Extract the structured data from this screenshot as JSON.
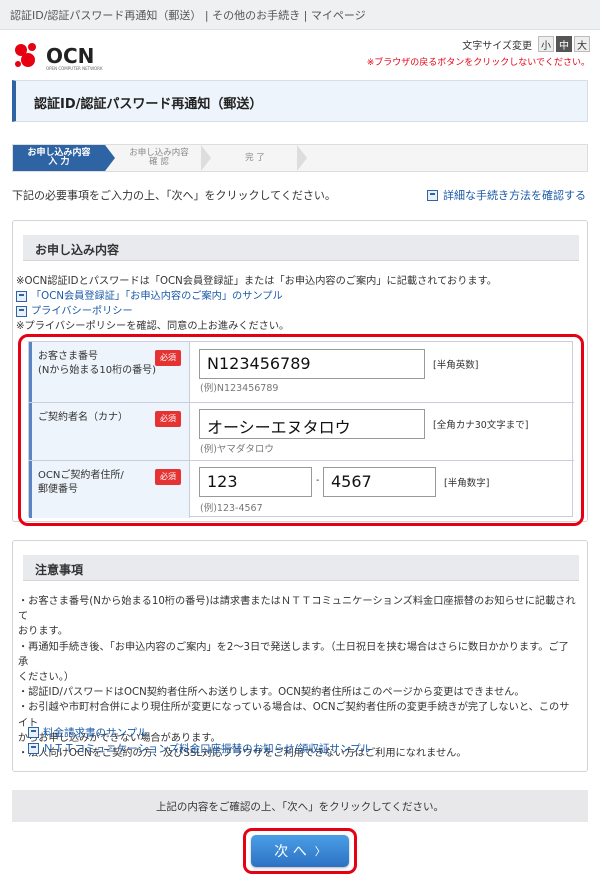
{
  "breadcrumb": "認証ID/認証パスワード再通知（郵送） | その他のお手続き | マイページ",
  "logo": {
    "text": "OCN",
    "sub": "OPEN COMPUTER NETWORK"
  },
  "font_size": {
    "label": "文字サイズ変更",
    "small": "小",
    "medium": "中",
    "large": "大"
  },
  "browser_warning": "※ブラウザの戻るボタンをクリックしないでください。",
  "page_title": "認証ID/認証パスワード再通知（郵送）",
  "steps": [
    {
      "line1": "お申し込み内容",
      "line2": "入 力"
    },
    {
      "line1": "お申し込み内容",
      "line2": "確 認"
    },
    {
      "line1": "完 了",
      "line2": ""
    }
  ],
  "instruction": "下記の必要事項をご入力の上、「次へ」をクリックしてください。",
  "detail_link": "詳細な手続き方法を確認する",
  "section1": {
    "title": "お申し込み内容",
    "note1": "※OCN認証IDとパスワードは「OCN会員登録証」または「お申込内容のご案内」に記載されております。",
    "link1": "「OCN会員登録証」「お申込内容のご案内」のサンプル",
    "link2": "プライバシーポリシー",
    "note2": "※プライバシーポリシーを確認、同意の上お進みください。"
  },
  "required_label": "必須",
  "form": {
    "customer": {
      "label1": "お客さま番号",
      "label2": "(Nから始まる10桁の番号)",
      "value": "N123456789",
      "hint": "[半角英数]",
      "example": "(例)N123456789"
    },
    "name": {
      "label1": "ご契約者名（カナ）",
      "value": "オーシーエヌタロウ",
      "hint": "[全角カナ30文字まで]",
      "example": "(例)ヤマダタロウ"
    },
    "zip": {
      "label1": "OCNご契約者住所/",
      "label2": "郵便番号",
      "value1": "123",
      "sep": "-",
      "value2": "4567",
      "hint": "[半角数字]",
      "example": "(例)123-4567"
    }
  },
  "section2": {
    "title": "注意事項",
    "lines": [
      "・お客さま番号(Nから始まる10桁の番号)は請求書またはＮＴＴコミュニケーションズ料金口座振替のお知らせに記載されて",
      "おります。",
      "・再通知手続き後、「お申込内容のご案内」を2～3日で発送します。（土日祝日を挟む場合はさらに数日かかります。ご了承",
      "ください。）",
      "・認証ID/パスワードはOCN契約者住所へお送りします。OCN契約者住所はこのページから変更はできません。",
      "・お引越や市町村合併により現住所が変更になっている場合は、OCNご契約者住所の変更手続きが完了しないと、このサイト",
      "からお申し込みができない場合があります。",
      "・法人向けOCNをご契約の方、及びSSL対応ブラウザをご利用できない方はご利用になれません。"
    ],
    "link1": "料金請求書のサンプル",
    "link2": "ＮＴＴコミュニケーションズ料金口座振替のお知らせ/領収証サンプル"
  },
  "bottom_instruction": "上記の内容をご確認の上、「次へ」をクリックしてください。",
  "next_button": "次 へ",
  "next_arrow": "〉",
  "colors": {
    "accent": "#2e63a4",
    "highlight": "#e60012",
    "link": "#1a5aa8"
  }
}
